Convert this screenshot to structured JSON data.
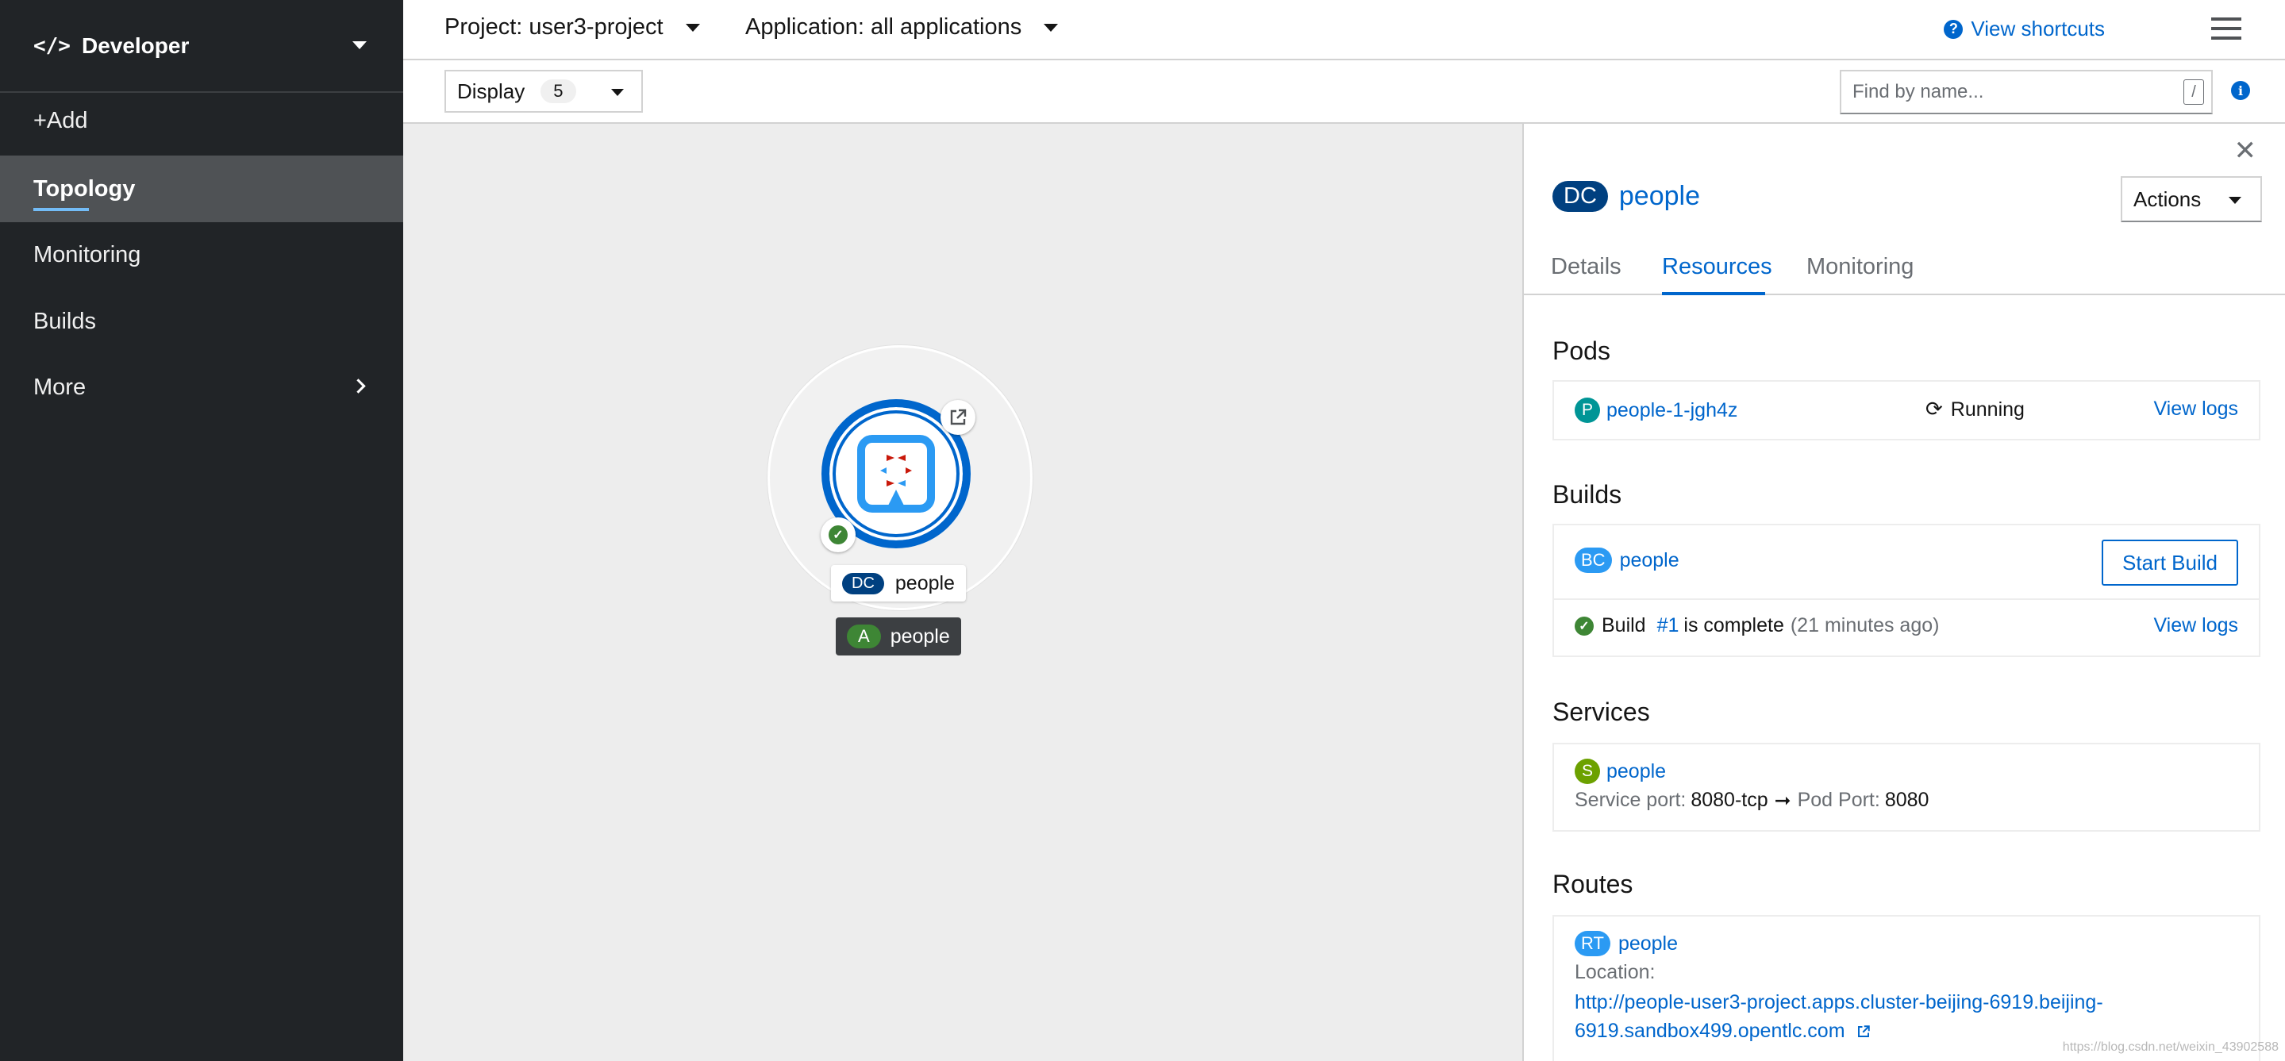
{
  "sidebar": {
    "perspective": "Developer",
    "items": [
      {
        "label": "+Add"
      },
      {
        "label": "Topology"
      },
      {
        "label": "Monitoring"
      },
      {
        "label": "Builds"
      },
      {
        "label": "More"
      }
    ]
  },
  "topbar": {
    "project": "Project: user3-project",
    "application": "Application: all applications",
    "shortcuts": "View shortcuts"
  },
  "toolbar": {
    "display_label": "Display",
    "display_count": "5",
    "find_placeholder": "Find by name...",
    "find_key": "/"
  },
  "topology": {
    "node_kind": "DC",
    "node_name": "people",
    "app_kind": "A",
    "app_name": "people"
  },
  "panel": {
    "kind": "DC",
    "name": "people",
    "actions_label": "Actions",
    "tabs": [
      {
        "label": "Details"
      },
      {
        "label": "Resources"
      },
      {
        "label": "Monitoring"
      }
    ],
    "pods": {
      "title": "Pods",
      "badge": "P",
      "name": "people-1-jgh4z",
      "status": "Running",
      "view_logs": "View logs"
    },
    "builds": {
      "title": "Builds",
      "badge": "BC",
      "name": "people",
      "start_build": "Start Build",
      "build_word": "Build",
      "build_num": "#1",
      "complete_text": "is complete",
      "ago": "(21 minutes ago)",
      "view_logs": "View logs"
    },
    "services": {
      "title": "Services",
      "badge": "S",
      "name": "people",
      "service_port_label": "Service port:",
      "service_port": "8080-tcp",
      "pod_port_label": "Pod Port:",
      "pod_port": "8080"
    },
    "routes": {
      "title": "Routes",
      "badge": "RT",
      "name": "people",
      "location_label": "Location:",
      "url_line1": "http://people-user3-project.apps.cluster-beijing-6919.beijing-",
      "url_line2": "6919.sandbox499.opentlc.com"
    }
  },
  "watermark": "https://blog.csdn.net/weixin_43902588",
  "colors": {
    "accent": "#0066cc",
    "sidebar_bg": "#212427",
    "canvas_bg": "#ededed",
    "dc_badge": "#004080",
    "success": "#3e8635"
  }
}
